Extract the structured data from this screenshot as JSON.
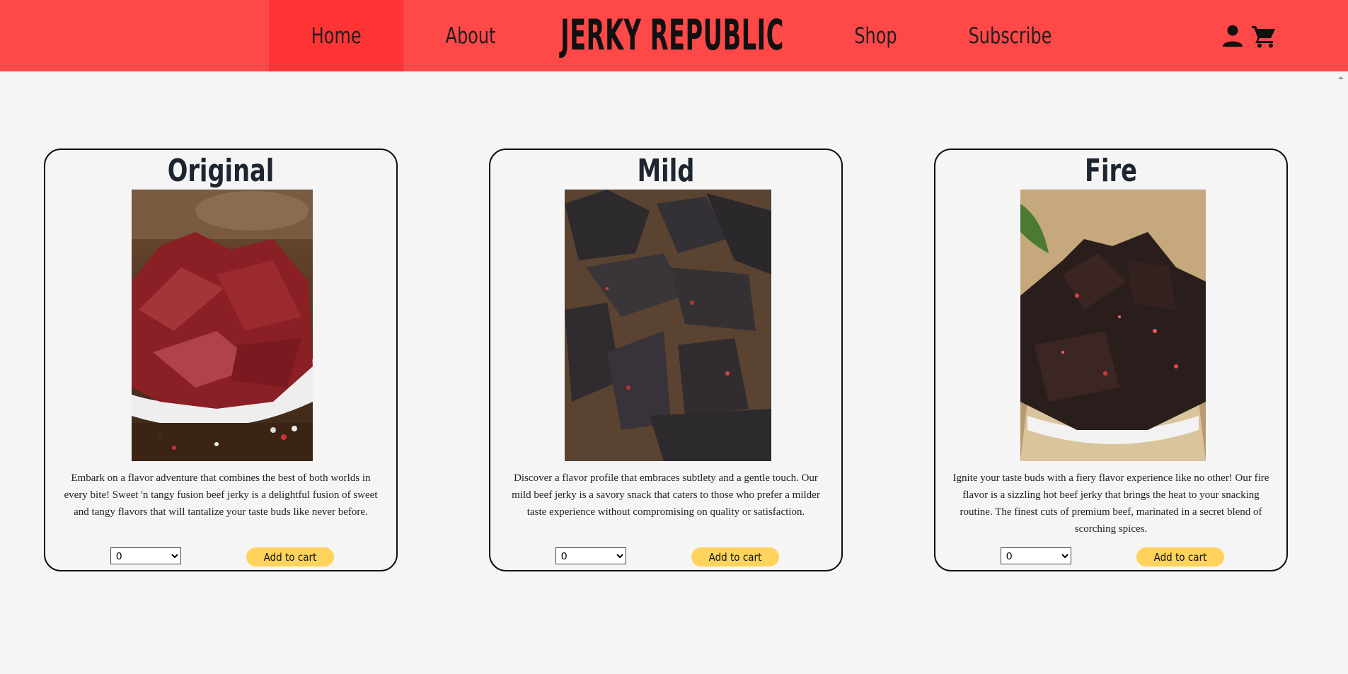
{
  "header": {
    "logo": "JERKY REPUBLIC",
    "nav": {
      "home": "Home",
      "about": "About",
      "shop": "Shop",
      "subscribe": "Subscribe"
    },
    "icons": {
      "account": "user-icon",
      "cart": "cart-icon"
    },
    "colors": {
      "bar": "#ff4848",
      "active": "#ff3434"
    }
  },
  "products": [
    {
      "title": "Original",
      "description": "Embark on a flavor adventure that combines the best of both worlds in every bite! Sweet 'n tangy fusion beef jerky is a delightful fusion of sweet and tangy flavors that will tantalize your taste buds like never before.",
      "quantity": "0",
      "button": "Add to cart"
    },
    {
      "title": "Mild",
      "description": "Discover a flavor profile that embraces subtlety and a gentle touch. Our mild beef jerky is a savory snack that caters to those who prefer a milder taste experience without compromising on quality or satisfaction.",
      "quantity": "0",
      "button": "Add to cart"
    },
    {
      "title": "Fire",
      "description": "Ignite your taste buds with a fiery flavor experience like no other! Our fire flavor is a sizzling hot beef jerky that brings the heat to your snacking routine. The finest cuts of premium beef, marinated in a secret blend of scorching spices.",
      "quantity": "0",
      "button": "Add to cart"
    }
  ],
  "accent_button_color": "#ffd35c"
}
